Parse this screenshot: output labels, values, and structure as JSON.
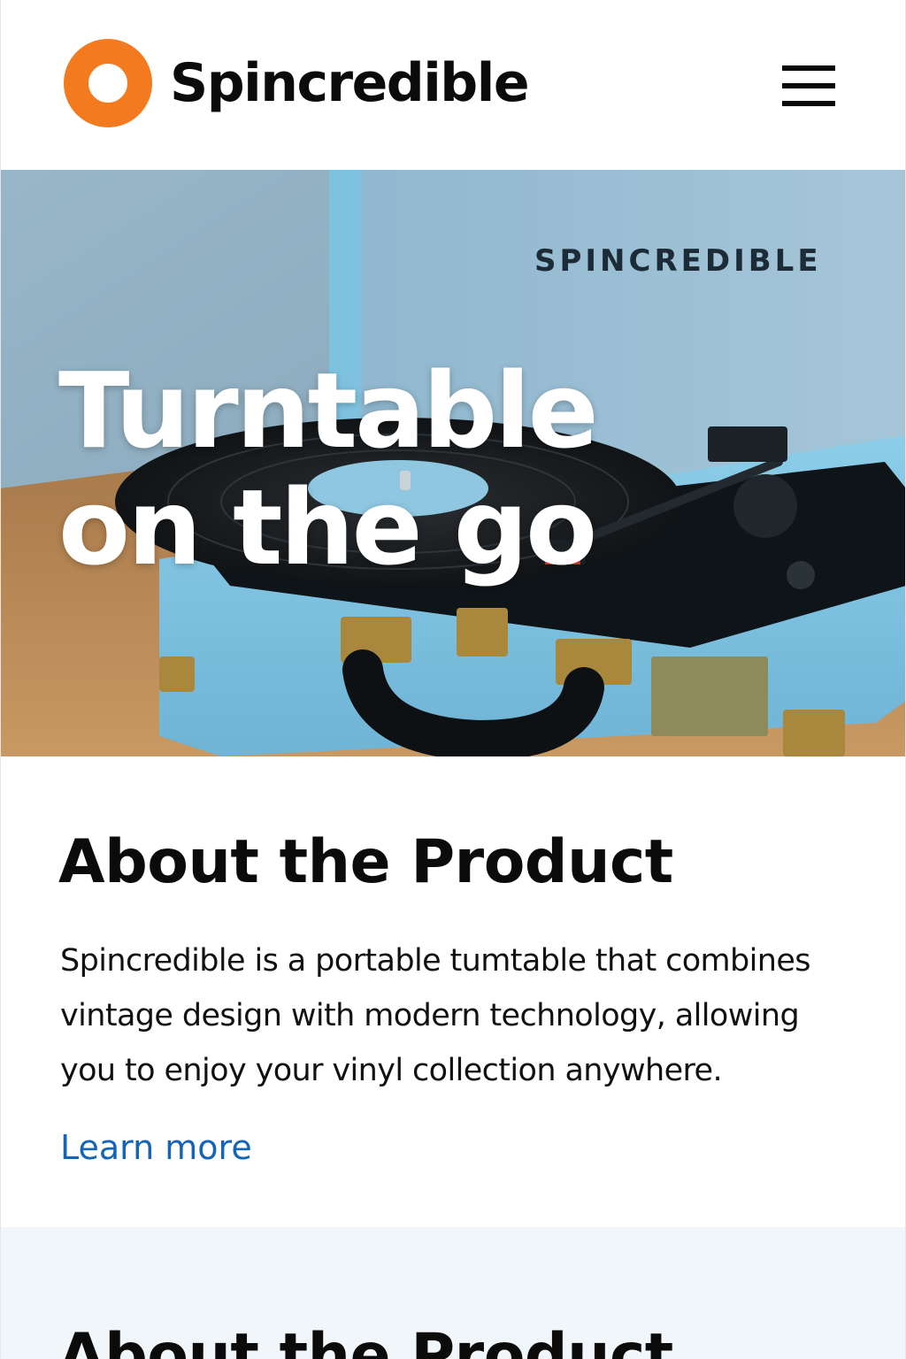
{
  "header": {
    "brand_name": "Spincredible",
    "logo_icon": "orange-ring-logo",
    "menu_icon": "hamburger-menu-icon",
    "brand_color": "#F47A20"
  },
  "hero": {
    "title_line_1": "Turntable",
    "title_line_2": "on the go",
    "case_label": "SPINCREDIBLE",
    "image_subject": "turquoise suitcase record player with vinyl record"
  },
  "about": {
    "heading": "About the Product",
    "body": "Spincredible is a portable tumtable that combines vintage design with modern technology, allowing you to enjoy your vinyl collection anywhere.",
    "link_label": "Learn more",
    "link_color": "#1565B7"
  },
  "about_repeat": {
    "heading": "About the Product"
  },
  "colors": {
    "page_background": "#FFFFFF",
    "second_section_background": "#F1F6FB",
    "text": "#0B0B0B"
  }
}
